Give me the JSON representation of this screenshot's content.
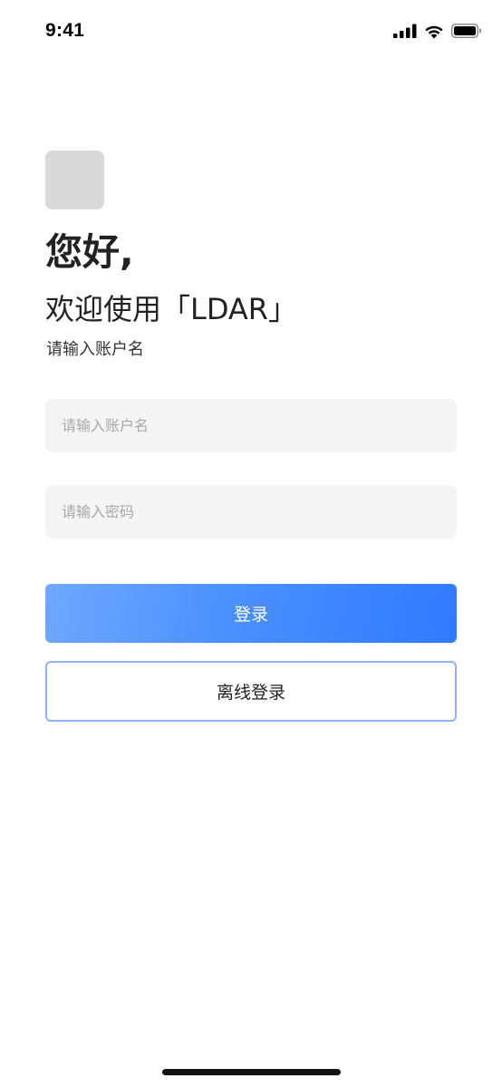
{
  "status_bar": {
    "time": "9:41",
    "icons": [
      "cellular-signal-icon",
      "wifi-icon",
      "battery-icon"
    ]
  },
  "logo": {
    "color": "#d9d9d9"
  },
  "header": {
    "greeting": "您好,",
    "welcome": "欢迎使用「LDAR」",
    "subtitle": "请输入账户名"
  },
  "form": {
    "account_placeholder": "请输入账户名",
    "account_value": "",
    "password_placeholder": "请输入密码",
    "password_value": ""
  },
  "buttons": {
    "login_label": "登录",
    "offline_login_label": "离线登录"
  },
  "colors": {
    "primary_start": "#6ea8ff",
    "primary_end": "#2f7aff",
    "outline_border": "#8bb5f0",
    "input_bg": "#f4f4f5"
  }
}
